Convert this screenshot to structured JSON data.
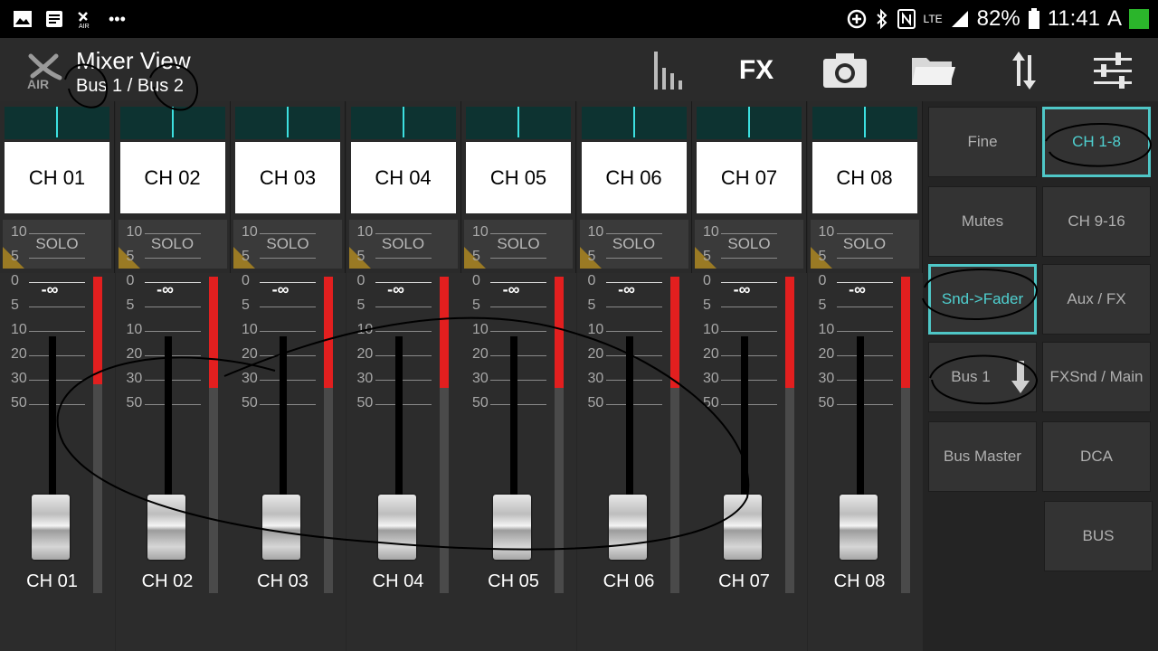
{
  "statusbar": {
    "battery": "82%",
    "time": "11:41",
    "carrier_suffix": "A",
    "network": "LTE",
    "icons": [
      "gallery-icon",
      "notes-icon",
      "x-air-icon",
      "more-icon",
      "data-saver-icon",
      "bluetooth-icon",
      "nfc-icon",
      "signal-icon",
      "battery-icon"
    ]
  },
  "header": {
    "title": "Mixer View",
    "subtitle": "Bus 1 / Bus 2",
    "logo_text": "AIR",
    "fx_label": "FX",
    "icons": [
      "meters-icon",
      "fx-icon",
      "camera-icon",
      "folder-icon",
      "sync-icon",
      "settings-icon"
    ]
  },
  "channels": [
    {
      "name": "CH 01",
      "label": "CH 01",
      "solo": "SOLO",
      "db": "-∞",
      "meter_level": 0.34,
      "fader_db": "-∞"
    },
    {
      "name": "CH 02",
      "label": "CH 02",
      "solo": "SOLO",
      "db": "-∞",
      "meter_level": 0.35,
      "fader_db": "-∞"
    },
    {
      "name": "CH 03",
      "label": "CH 03",
      "solo": "SOLO",
      "db": "-∞",
      "meter_level": 0.35,
      "fader_db": "-∞"
    },
    {
      "name": "CH 04",
      "label": "CH 04",
      "solo": "SOLO",
      "db": "-∞",
      "meter_level": 0.35,
      "fader_db": "-∞"
    },
    {
      "name": "CH 05",
      "label": "CH 05",
      "solo": "SOLO",
      "db": "-∞",
      "meter_level": 0.35,
      "fader_db": "-∞"
    },
    {
      "name": "CH 06",
      "label": "CH 06",
      "solo": "SOLO",
      "db": "-∞",
      "meter_level": 0.35,
      "fader_db": "-∞"
    },
    {
      "name": "CH 07",
      "label": "CH 07",
      "solo": "SOLO",
      "db": "-∞",
      "meter_level": 0.35,
      "fader_db": "-∞"
    },
    {
      "name": "CH 08",
      "label": "CH 08",
      "solo": "SOLO",
      "db": "-∞",
      "meter_level": 0.35,
      "fader_db": "-∞"
    }
  ],
  "scale": [
    "10",
    "5",
    "0",
    "5",
    "10",
    "20",
    "30",
    "50"
  ],
  "panel": {
    "buttons": [
      {
        "id": "fine",
        "label": "Fine",
        "active": false
      },
      {
        "id": "ch1-8",
        "label": "CH 1-8",
        "active": true
      },
      {
        "id": "mutes",
        "label": "Mutes",
        "active": false
      },
      {
        "id": "ch9-16",
        "label": "CH 9-16",
        "active": false
      },
      {
        "id": "snd-fader",
        "label": "Snd->Fader",
        "active": true
      },
      {
        "id": "aux-fx",
        "label": "Aux / FX",
        "active": false
      },
      {
        "id": "bus1",
        "label": "Bus 1",
        "active": false
      },
      {
        "id": "fxsnd-main",
        "label": "FXSnd / Main",
        "active": false
      },
      {
        "id": "bus-master",
        "label": "Bus Master",
        "active": false
      },
      {
        "id": "dca",
        "label": "DCA",
        "active": false
      },
      {
        "id": "bus",
        "label": "BUS",
        "active": false
      }
    ]
  },
  "colors": {
    "accent": "#4fc7c7",
    "meter_red": "#e21f1f",
    "meter_top": "#0d3331",
    "solo_corner": "#9a7a24"
  }
}
